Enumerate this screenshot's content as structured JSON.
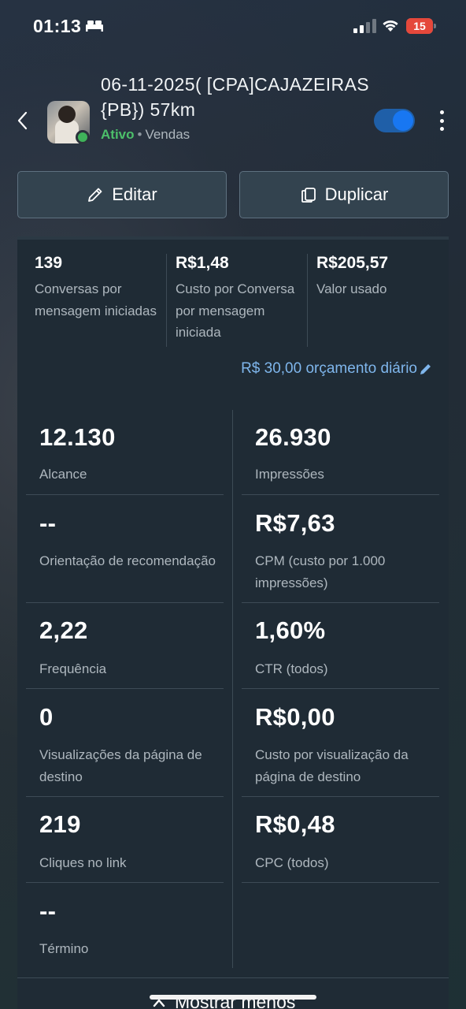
{
  "status_bar": {
    "time": "01:13",
    "battery_level": "15",
    "battery_color": "#e5483b",
    "icons": [
      "bed-icon",
      "signal-icon",
      "wifi-icon",
      "battery-icon"
    ]
  },
  "header": {
    "title": "06-11-2025( [CPA]CAJAZEIRAS{PB}) 57km",
    "status": "Ativo",
    "separator": "•",
    "objective": "Vendas",
    "toggle_on": true,
    "status_color": "#4cbf6a"
  },
  "actions": {
    "edit_label": "Editar",
    "duplicate_label": "Duplicar"
  },
  "summary": [
    {
      "value": "139",
      "label": "Conversas por mensagem iniciadas"
    },
    {
      "value": "R$1,48",
      "label": "Custo por Conversa por mensagem iniciada"
    },
    {
      "value": "R$205,57",
      "label": "Valor usado"
    }
  ],
  "budget": {
    "text": "R$ 30,00 orçamento diário"
  },
  "metrics_left": [
    {
      "value": "12.130",
      "label": "Alcance"
    },
    {
      "value": "--",
      "label": "Orientação de recomendação"
    },
    {
      "value": "2,22",
      "label": "Frequência"
    },
    {
      "value": "0",
      "label": "Visualizações da página de destino"
    },
    {
      "value": "219",
      "label": "Cliques no link"
    },
    {
      "value": "--",
      "label": "Término"
    }
  ],
  "metrics_right": [
    {
      "value": "26.930",
      "label": "Impressões"
    },
    {
      "value": "R$7,63",
      "label": "CPM (custo por 1.000 impressões)"
    },
    {
      "value": "1,60%",
      "label": "CTR (todos)"
    },
    {
      "value": "R$0,00",
      "label": "Custo por visualização da página de destino"
    },
    {
      "value": "R$0,48",
      "label": "CPC (todos)"
    }
  ],
  "footer": {
    "show_less_label": "Mostrar menos"
  },
  "colors": {
    "accent": "#1877f2",
    "link": "#7fb6ec"
  }
}
